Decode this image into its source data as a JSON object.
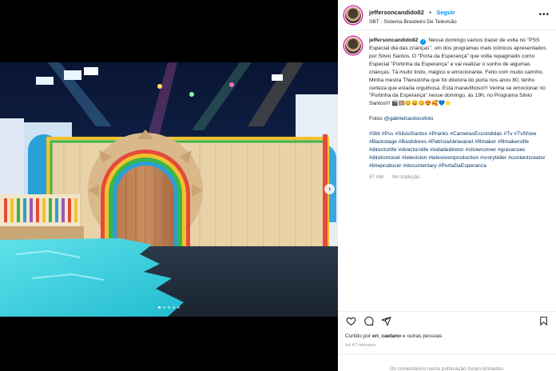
{
  "post": {
    "username": "jeffersoncandido82",
    "separator": "•",
    "follow_label": "Seguir",
    "subtitle": "SBT - Sistema Brasileiro De Televisão",
    "more_label": "•••"
  },
  "caption": {
    "username": "jeffersoncandido82",
    "text": "Nesse domingo vamos trazer de volta no \"PSS Especial dia das crianças\", um dos programas mais icônicos apresentados por Silvio Santos. O \"Porta da Esperança\" que volta repaginado como Especial \"Portinha da Esperança\" e vai realizar o sonho de algumas crianças. Tá muito lindo, mágico e emocionante. Feito com muito carinho. Minha mestra Therezinha que foi diretora do porta nos anos 80, tenho certeza que estaria orgulhosa. Está maravilhoso!!! Venha se emocionar no \"Portinha da Esperança\" nesse domingo, às 19h, no Programa Silvio Santos!!! 🎬🎞️😊😄😊😍🥰💙⭐",
    "photos_prefix": "Fotos ",
    "photos_link": "@gabrielcardosofoto",
    "hashtags": "#Sbt #Pss #SilvioSantos #Pranks #CamerasEscondidas #Tv #TvShow #Backstage #Bastidores #PatriciaAbravanel #filmaker #filmakerslife #directorlife #directorslife #vidadediretor #showrunner #gravacoes #diretornoset #television #televisionproduction #sroryteller #contentcreator #lineproducer #documentary #PortaDaEsperanca",
    "age": "47 min",
    "translate_label": "Ver tradução"
  },
  "actions": {
    "like_icon": "heart-icon",
    "comment_icon": "comment-icon",
    "share_icon": "share-icon",
    "save_icon": "bookmark-icon"
  },
  "likes": {
    "prefix": "Curtido por ",
    "user": "eri_caetano",
    "suffix": " e outras pessoas"
  },
  "timestamp": "há 47 minutos",
  "footer_text": "Os comentários nesta publicação foram limitados.",
  "carousel": {
    "total": 5,
    "active": 0
  },
  "colors": {
    "link_blue": "#0095f6",
    "hashtag_blue": "#00376b",
    "muted": "#8e8e8e"
  }
}
